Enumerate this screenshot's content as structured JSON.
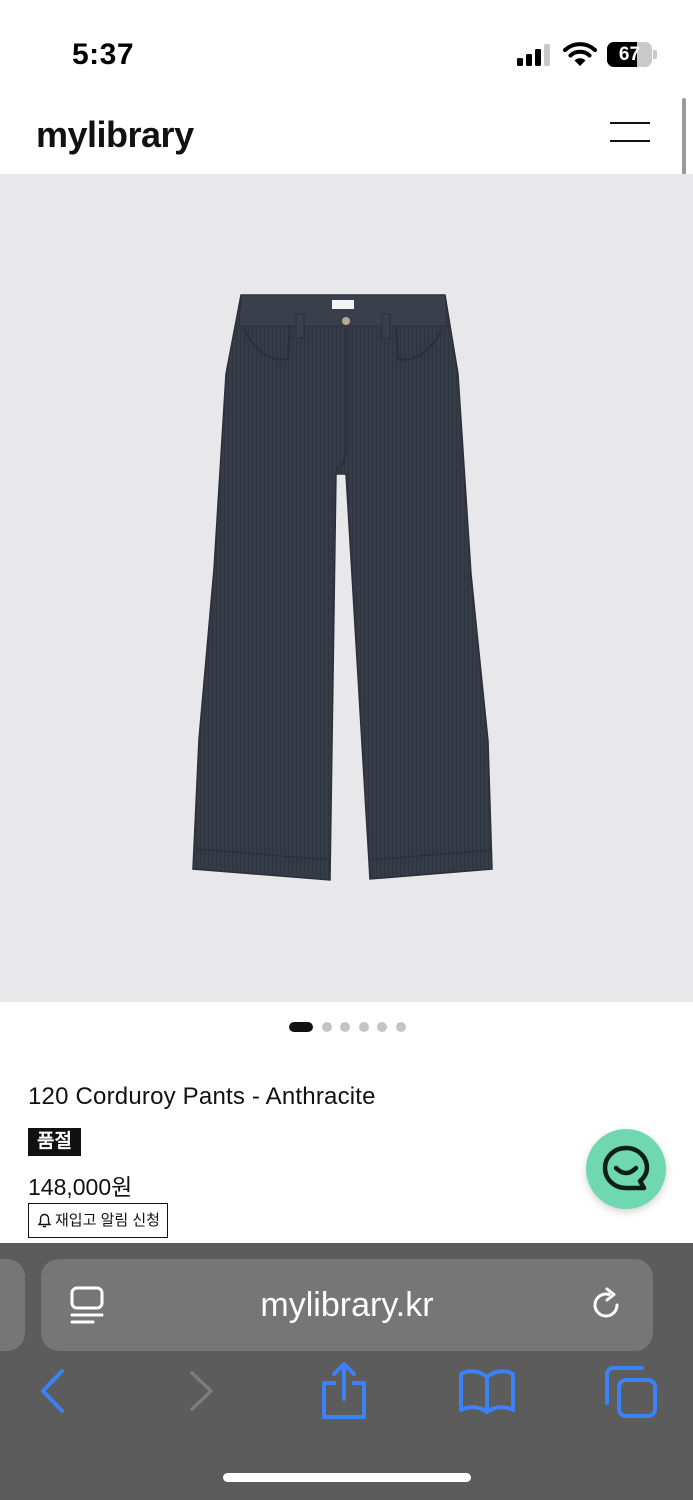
{
  "status_bar": {
    "time": "5:37",
    "battery_percent": "67",
    "battery_level": 0.67,
    "signal_bars": 3,
    "icons": [
      "cellular-signal-icon",
      "wifi-icon",
      "battery-icon"
    ]
  },
  "header": {
    "logo": "mylibrary",
    "menu_icon": "hamburger-menu-icon"
  },
  "gallery": {
    "image_subject": "corduroy pants",
    "total_images": 6,
    "active_index": 1
  },
  "product": {
    "title": "120 Corduroy Pants - Anthracite",
    "status_badge": "품절",
    "price": "148,000원",
    "restock_button": "재입고 알림 신청",
    "restock_icon": "bell-icon"
  },
  "chat_button": {
    "icon": "chat-smile-icon",
    "color": "#6fd8b0"
  },
  "browser": {
    "url": "mylibrary.kr",
    "icons": [
      "reader-icon",
      "reload-icon",
      "back-icon",
      "forward-icon",
      "share-icon",
      "bookmarks-icon",
      "tabs-icon"
    ],
    "accent_color": "#3b82f6"
  },
  "colors": {
    "image_background": "#e8e8ea",
    "pants": "#363c47",
    "browser_bar": "#5c5c5c"
  }
}
